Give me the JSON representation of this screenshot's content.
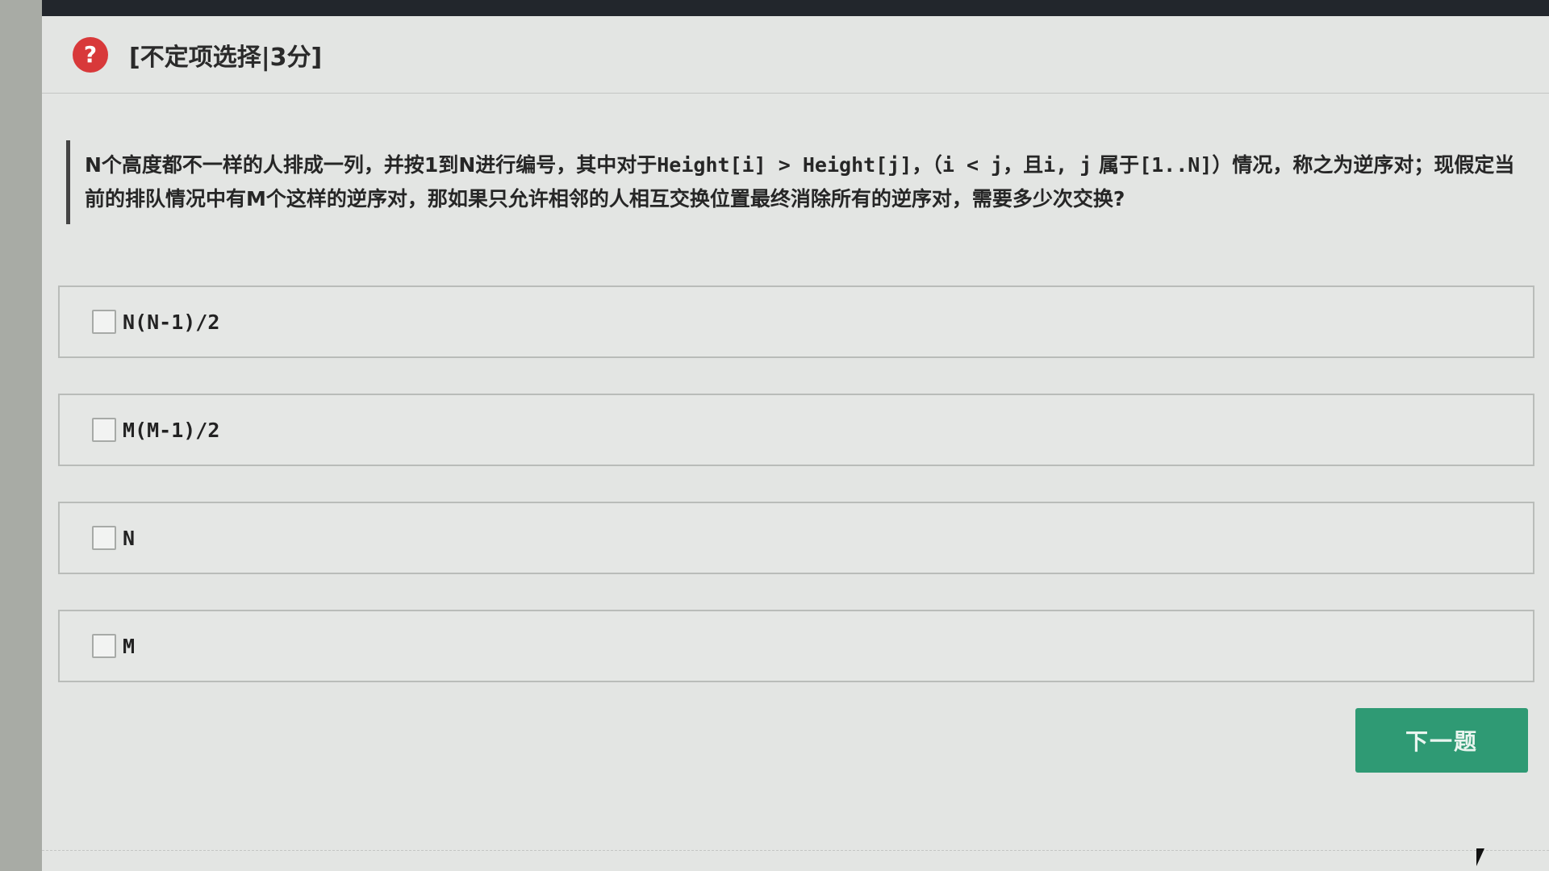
{
  "header": {
    "icon": "question-circle-icon",
    "icon_glyph": "?",
    "question_type": "[不定项选择|3分]"
  },
  "question": {
    "text_1": "N个高度都不一样的人排成一列，并按1到N进行编号，其中对于",
    "code_1": "Height[i] > Height[j]",
    "text_2": "，（",
    "code_2": "i < j",
    "text_3": "，且",
    "code_3": "i, j",
    "text_4": " 属于",
    "code_4": "[1..N]",
    "text_5": "）情况，称之为逆序对；现假定当前的排队情况中有M个这样的逆序对，那如果只允许相邻的人相互交换位置最终消除所有的逆序对，需要多少次交换?"
  },
  "options": [
    {
      "label": "N(N-1)/2",
      "checked": false
    },
    {
      "label": "M(M-1)/2",
      "checked": false
    },
    {
      "label": "N",
      "checked": false
    },
    {
      "label": "M",
      "checked": false
    }
  ],
  "buttons": {
    "next_label": "下一题"
  },
  "colors": {
    "accent": "#2f9a74",
    "icon_red": "#d8393a"
  }
}
